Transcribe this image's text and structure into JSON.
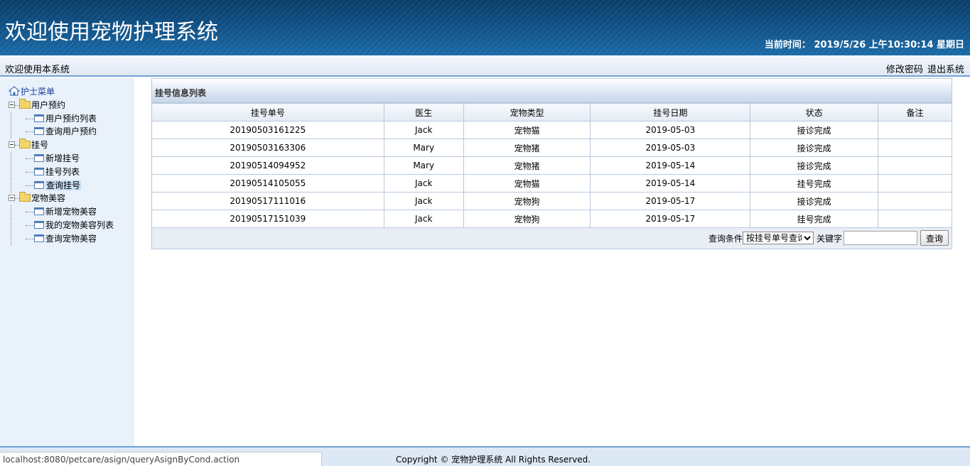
{
  "header": {
    "title": "欢迎使用宠物护理系统",
    "time_label": "当前时间：",
    "time_value": "2019/5/26 上午10:30:14 星期日"
  },
  "subbar": {
    "welcome": "欢迎使用本系统",
    "change_password": "修改密码",
    "logout": "退出系统"
  },
  "sidebar": {
    "root": "护士菜单",
    "groups": [
      {
        "label": "用户预约",
        "items": [
          "用户预约列表",
          "查询用户预约"
        ]
      },
      {
        "label": "挂号",
        "items": [
          "新增挂号",
          "挂号列表",
          "查询挂号"
        ]
      },
      {
        "label": "宠物美容",
        "items": [
          "新增宠物美容",
          "我的宠物美容列表",
          "查询宠物美容"
        ]
      }
    ],
    "selected": "查询挂号"
  },
  "panel": {
    "title": "挂号信息列表",
    "columns": [
      "挂号单号",
      "医生",
      "宠物类型",
      "挂号日期",
      "状态",
      "备注"
    ],
    "rows": [
      [
        "20190503161225",
        "Jack",
        "宠物猫",
        "2019-05-03",
        "接诊完成",
        ""
      ],
      [
        "20190503163306",
        "Mary",
        "宠物猪",
        "2019-05-03",
        "接诊完成",
        ""
      ],
      [
        "20190514094952",
        "Mary",
        "宠物猪",
        "2019-05-14",
        "接诊完成",
        ""
      ],
      [
        "20190514105055",
        "Jack",
        "宠物猫",
        "2019-05-14",
        "挂号完成",
        ""
      ],
      [
        "20190517111016",
        "Jack",
        "宠物狗",
        "2019-05-17",
        "接诊完成",
        ""
      ],
      [
        "20190517151039",
        "Jack",
        "宠物狗",
        "2019-05-17",
        "挂号完成",
        ""
      ]
    ],
    "search": {
      "condition_label": "查询条件",
      "condition_value": "按挂号单号查询",
      "keyword_label": "关键字",
      "keyword_value": "",
      "button": "查询"
    }
  },
  "footer": {
    "copyright": "Copyright © 宠物护理系统 All Rights Reserved."
  },
  "statusbar": {
    "url": "localhost:8080/petcare/asign/queryAsignByCond.action"
  },
  "colors": {
    "header_bg": "#0f4f84",
    "sidebar_bg": "#e9f1fb",
    "border": "#b8c9dc"
  }
}
